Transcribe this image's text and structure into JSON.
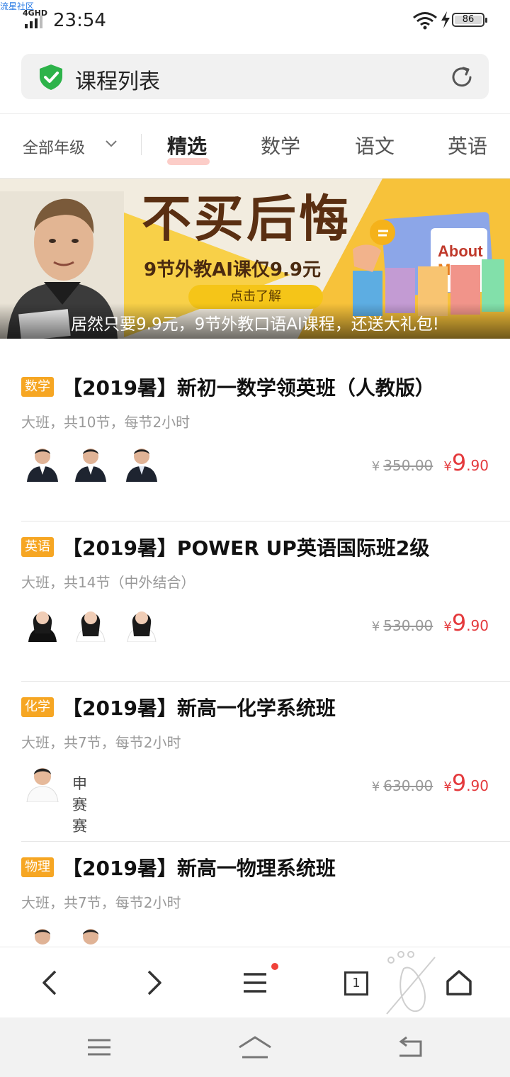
{
  "watermark": "流星社区",
  "status_bar": {
    "network": "4GHD",
    "time": "23:54",
    "battery": "86"
  },
  "address_bar": {
    "title": "课程列表"
  },
  "tabs": {
    "grade_filter": "全部年级",
    "items": [
      {
        "label": "精选",
        "active": true
      },
      {
        "label": "数学",
        "active": false
      },
      {
        "label": "语文",
        "active": false
      },
      {
        "label": "英语",
        "active": false
      }
    ]
  },
  "banner": {
    "title": "不买后悔",
    "subtitle": "9节外教AI课仅9.9元",
    "button": "点击了解",
    "caption": "居然只要9.9元，9节外教口语AI课程，还送大礼包!"
  },
  "courses": [
    {
      "subject": "数学",
      "title": "【2019暑】新初一数学领英班（人教版）",
      "desc": "大班，共10节，每节2小时",
      "original_price": "350.00",
      "price_int": "9",
      "price_dec": ".90",
      "teacher_name": ""
    },
    {
      "subject": "英语",
      "title": "【2019暑】POWER UP英语国际班2级",
      "desc": "大班，共14节（中外结合）",
      "original_price": "530.00",
      "price_int": "9",
      "price_dec": ".90",
      "teacher_name": ""
    },
    {
      "subject": "化学",
      "title": "【2019暑】新高一化学系统班",
      "desc": "大班，共7节，每节2小时",
      "original_price": "630.00",
      "price_int": "9",
      "price_dec": ".90",
      "teacher_name": "申赛赛"
    },
    {
      "subject": "物理",
      "title": "【2019暑】新高一物理系统班",
      "desc": "大班，共7节，每节2小时",
      "original_price": "",
      "price_int": "",
      "price_dec": "",
      "teacher_name": ""
    }
  ],
  "currency": "¥",
  "browser_bar": {
    "tab_count": "1"
  },
  "colors": {
    "accent_red": "#e4393c",
    "subject_tag": "#f6a623",
    "shield_green": "#2db34a"
  }
}
